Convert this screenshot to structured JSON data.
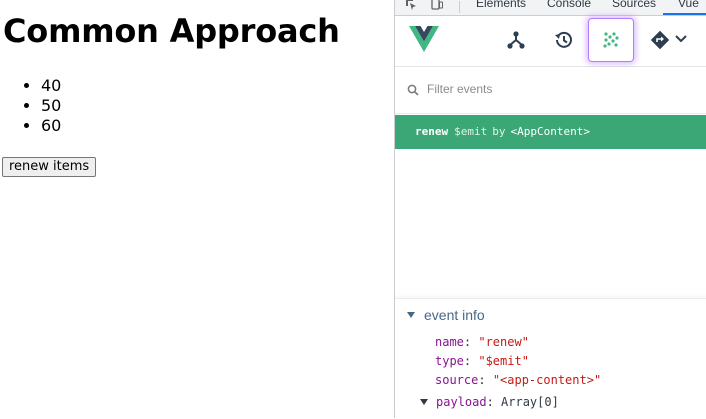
{
  "page": {
    "title": "Common Approach",
    "items": [
      "40",
      "50",
      "60"
    ],
    "button_label": "renew items"
  },
  "devtools": {
    "tabs": [
      "Elements",
      "Console",
      "Sources",
      "Vue"
    ],
    "active_tab": "Vue",
    "toolbar": {
      "icons": [
        "component-tree-icon",
        "timeline-icon",
        "events-icon",
        "router-icon"
      ],
      "active": "events-icon"
    },
    "filter": {
      "placeholder": "Filter events",
      "value": ""
    },
    "event": {
      "name": "renew",
      "type": "$emit",
      "by": "by",
      "component": "<AppContent>",
      "highlight_color": "#3ba776"
    },
    "event_info": {
      "heading": "event info",
      "fields": [
        {
          "key": "name",
          "value": "\"renew\""
        },
        {
          "key": "type",
          "value": "\"$emit\""
        },
        {
          "key": "source",
          "value": "\"<app-content>\""
        }
      ],
      "payload": {
        "key": "payload",
        "value": "Array[0]"
      }
    }
  }
}
